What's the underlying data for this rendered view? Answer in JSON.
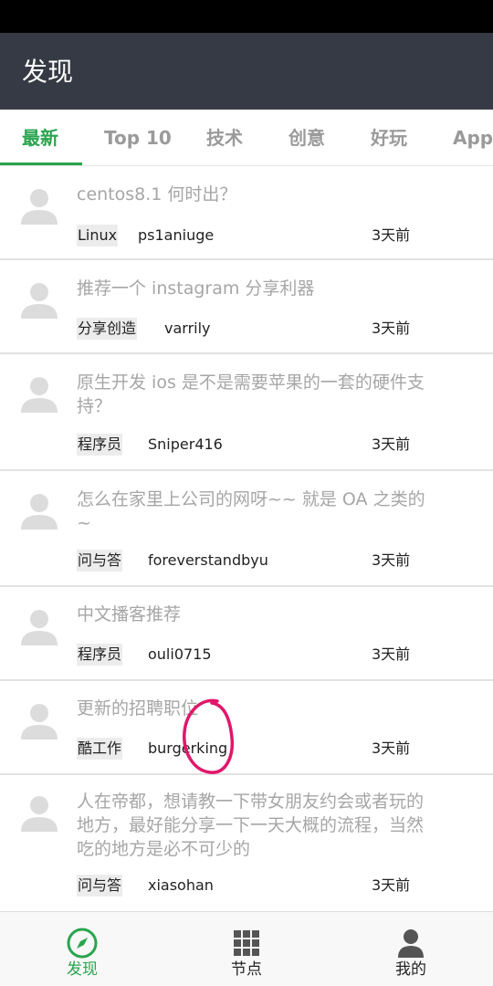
{
  "app_bar": {
    "title": "发现"
  },
  "tabs": [
    {
      "label": "最新",
      "active": true
    },
    {
      "label": "Top 10"
    },
    {
      "label": "技术"
    },
    {
      "label": "创意"
    },
    {
      "label": "好玩"
    },
    {
      "label": "Apple"
    }
  ],
  "topics": [
    {
      "title": "centos8.1 何时出？",
      "node": "Linux",
      "user": "ps1aniuge",
      "time": "3天前"
    },
    {
      "title": "推荐一个 instagram 分享利器",
      "node": "分享创造",
      "user": "varrily",
      "time": "3天前"
    },
    {
      "title": "原生开发 ios 是不是需要苹果的一套的硬件支持？",
      "node": "程序员",
      "user": "Sniper416",
      "time": "3天前"
    },
    {
      "title": "怎么在家里上公司的网呀~~ 就是 OA 之类的~",
      "node": "问与答",
      "user": "foreverstandbyu",
      "time": "3天前"
    },
    {
      "title": "中文播客推荐",
      "node": "程序员",
      "user": "ouli0715",
      "time": "3天前"
    },
    {
      "title": "更新的招聘职位",
      "node": "酷工作",
      "user": "burgerking",
      "time": "3天前"
    },
    {
      "title": "人在帝都，想请教一下带女朋友约会或者玩的地方，最好能分享一下一天大概的流程，当然吃的地方是必不可少的",
      "node": "问与答",
      "user": "xiasohan",
      "time": "3天前"
    }
  ],
  "bottom_nav": [
    {
      "label": "发现",
      "icon": "compass-icon",
      "active": true
    },
    {
      "label": "节点",
      "icon": "grid-icon"
    },
    {
      "label": "我的",
      "icon": "person-icon"
    }
  ],
  "colors": {
    "accent": "#2aa44f",
    "app_bar": "#353a44",
    "annotation": "#e0176a"
  }
}
